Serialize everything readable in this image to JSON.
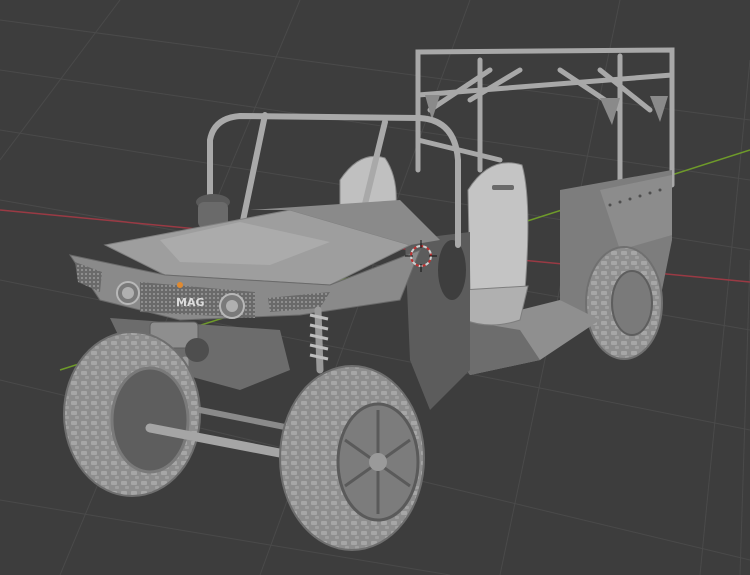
{
  "viewport": {
    "background": "#3d3d3d",
    "grid_color": "#4a4a4a",
    "x_axis_color": "#9a3a44",
    "y_axis_color": "#6e9a2a"
  },
  "model": {
    "body_color": "#9c9c9c",
    "light_color": "#c2c2c2",
    "dark_color": "#5a5a5a",
    "tire_color": "#8c8c8c",
    "grille_badge": "MAG"
  },
  "gizmo": {
    "icon": "3d-cursor-icon",
    "ring_color": "#d0d0d0",
    "accent_color": "#c03030"
  }
}
